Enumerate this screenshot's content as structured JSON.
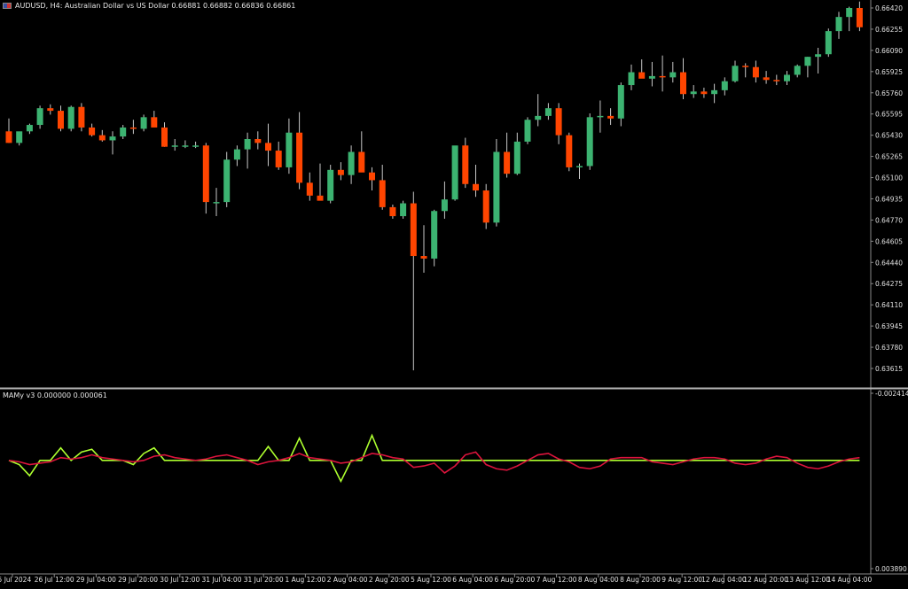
{
  "header": {
    "symbol_line": "AUDUSD, H4:  Australian Dollar vs US Dollar  0.66881 0.66882 0.66836 0.66861",
    "indicator_line": "MAMy v3 0.000000 0.000061"
  },
  "colors": {
    "background": "#000000",
    "bull": "#3cb371",
    "bear": "#ff4500",
    "wick": "#c8c8c8",
    "separator": "#b4b4b4",
    "line_main": "#adff2f",
    "line_signal": "#dc143c",
    "axis_text": "#e0e0e0"
  },
  "chart_data": [
    {
      "type": "candlestick",
      "title": "AUDUSD, H4:  Australian Dollar vs US Dollar",
      "ylim": [
        0.635,
        0.665
      ],
      "y_ticks": [
        "0.66420",
        "0.66255",
        "0.66090",
        "0.65925",
        "0.65760",
        "0.65595",
        "0.65430",
        "0.65265",
        "0.65100",
        "0.64935",
        "0.64770",
        "0.64605",
        "0.64440",
        "0.64275",
        "0.64110",
        "0.63945",
        "0.63780",
        "0.63615"
      ],
      "x_ticks": [
        "25 Jul 2024",
        "26 Jul 12:00",
        "29 Jul 04:00",
        "29 Jul 20:00",
        "30 Jul 12:00",
        "31 Jul 04:00",
        "31 Jul 20:00",
        "1 Aug 12:00",
        "2 Aug 04:00",
        "2 Aug 20:00",
        "5 Aug 12:00",
        "6 Aug 04:00",
        "6 Aug 20:00",
        "7 Aug 12:00",
        "8 Aug 04:00",
        "8 Aug 20:00",
        "9 Aug 12:00",
        "12 Aug 04:00",
        "12 Aug 20:00",
        "13 Aug 12:00",
        "14 Aug 04:00"
      ],
      "candles": [
        [
          0.6546,
          0.6556,
          0.6537,
          0.6537
        ],
        [
          0.6537,
          0.6545,
          0.6535,
          0.6546
        ],
        [
          0.6546,
          0.6552,
          0.6544,
          0.6551
        ],
        [
          0.6551,
          0.6566,
          0.6548,
          0.6564
        ],
        [
          0.6564,
          0.6567,
          0.6559,
          0.6562
        ],
        [
          0.6562,
          0.6566,
          0.6546,
          0.6548
        ],
        [
          0.6548,
          0.6566,
          0.6546,
          0.6565
        ],
        [
          0.6565,
          0.6568,
          0.6546,
          0.6549
        ],
        [
          0.6549,
          0.6552,
          0.6542,
          0.6543
        ],
        [
          0.6543,
          0.6547,
          0.6538,
          0.6539
        ],
        [
          0.6539,
          0.6546,
          0.6528,
          0.6542
        ],
        [
          0.6542,
          0.6551,
          0.654,
          0.6549
        ],
        [
          0.6549,
          0.6555,
          0.6544,
          0.6548
        ],
        [
          0.6548,
          0.6559,
          0.6546,
          0.6557
        ],
        [
          0.6557,
          0.6562,
          0.6551,
          0.6549
        ],
        [
          0.6549,
          0.6553,
          0.6534,
          0.6534
        ],
        [
          0.6534,
          0.654,
          0.6531,
          0.6535
        ],
        [
          0.6535,
          0.6539,
          0.6533,
          0.6535
        ],
        [
          0.6535,
          0.6538,
          0.6533,
          0.6535
        ],
        [
          0.6535,
          0.6537,
          0.6482,
          0.6491
        ],
        [
          0.6491,
          0.6502,
          0.648,
          0.6491
        ],
        [
          0.6491,
          0.653,
          0.6487,
          0.6524
        ],
        [
          0.6524,
          0.6535,
          0.6519,
          0.6532
        ],
        [
          0.6532,
          0.6545,
          0.6517,
          0.654
        ],
        [
          0.654,
          0.6546,
          0.6532,
          0.6537
        ],
        [
          0.6537,
          0.6552,
          0.6519,
          0.6531
        ],
        [
          0.6531,
          0.6538,
          0.6516,
          0.6518
        ],
        [
          0.6518,
          0.6556,
          0.6513,
          0.6545
        ],
        [
          0.6545,
          0.6561,
          0.6501,
          0.6506
        ],
        [
          0.6506,
          0.6514,
          0.6492,
          0.6496
        ],
        [
          0.6496,
          0.6521,
          0.6494,
          0.6492
        ],
        [
          0.6492,
          0.652,
          0.649,
          0.6516
        ],
        [
          0.6516,
          0.6522,
          0.6508,
          0.6512
        ],
        [
          0.6512,
          0.6535,
          0.6505,
          0.653
        ],
        [
          0.653,
          0.6546,
          0.652,
          0.6514
        ],
        [
          0.6514,
          0.6518,
          0.65,
          0.6508
        ],
        [
          0.6508,
          0.652,
          0.6485,
          0.6487
        ],
        [
          0.6487,
          0.6489,
          0.6478,
          0.648
        ],
        [
          0.648,
          0.6492,
          0.6478,
          0.649
        ],
        [
          0.649,
          0.6499,
          0.636,
          0.6449
        ],
        [
          0.6449,
          0.6473,
          0.6436,
          0.6447
        ],
        [
          0.6447,
          0.6485,
          0.6441,
          0.6484
        ],
        [
          0.6484,
          0.6507,
          0.6478,
          0.6493
        ],
        [
          0.6493,
          0.6533,
          0.6492,
          0.6535
        ],
        [
          0.6535,
          0.6541,
          0.6502,
          0.6505
        ],
        [
          0.6505,
          0.652,
          0.6495,
          0.65
        ],
        [
          0.65,
          0.6505,
          0.647,
          0.6475
        ],
        [
          0.6475,
          0.654,
          0.6472,
          0.653
        ],
        [
          0.653,
          0.6545,
          0.651,
          0.6513
        ],
        [
          0.6513,
          0.6545,
          0.6512,
          0.6538
        ],
        [
          0.6538,
          0.6557,
          0.6536,
          0.6555
        ],
        [
          0.6555,
          0.6575,
          0.655,
          0.6558
        ],
        [
          0.6558,
          0.6568,
          0.6555,
          0.6564
        ],
        [
          0.6564,
          0.6568,
          0.6536,
          0.6543
        ],
        [
          0.6543,
          0.6545,
          0.6515,
          0.6518
        ],
        [
          0.6518,
          0.6521,
          0.6509,
          0.6519
        ],
        [
          0.6519,
          0.656,
          0.6516,
          0.6557
        ],
        [
          0.6557,
          0.657,
          0.6545,
          0.6558
        ],
        [
          0.6558,
          0.6564,
          0.6551,
          0.6556
        ],
        [
          0.6556,
          0.6584,
          0.655,
          0.6582
        ],
        [
          0.6582,
          0.6598,
          0.6578,
          0.6592
        ],
        [
          0.6592,
          0.6602,
          0.6588,
          0.6587
        ],
        [
          0.6587,
          0.66,
          0.6581,
          0.6589
        ],
        [
          0.6589,
          0.6605,
          0.6577,
          0.6588
        ],
        [
          0.6588,
          0.66,
          0.6584,
          0.6592
        ],
        [
          0.6592,
          0.6603,
          0.6571,
          0.6575
        ],
        [
          0.6575,
          0.6582,
          0.6572,
          0.6577
        ],
        [
          0.6577,
          0.658,
          0.6572,
          0.6575
        ],
        [
          0.6575,
          0.6583,
          0.6568,
          0.6578
        ],
        [
          0.6578,
          0.6588,
          0.6574,
          0.6585
        ],
        [
          0.6585,
          0.6601,
          0.6584,
          0.6597
        ],
        [
          0.6597,
          0.6599,
          0.6588,
          0.6596
        ],
        [
          0.6596,
          0.6601,
          0.6584,
          0.6588
        ],
        [
          0.6588,
          0.6593,
          0.6583,
          0.6586
        ],
        [
          0.6586,
          0.659,
          0.6582,
          0.6585
        ],
        [
          0.6585,
          0.6593,
          0.6582,
          0.659
        ],
        [
          0.659,
          0.6598,
          0.6588,
          0.6597
        ],
        [
          0.6597,
          0.6604,
          0.6588,
          0.6604
        ],
        [
          0.6604,
          0.6611,
          0.6591,
          0.6606
        ],
        [
          0.6606,
          0.6626,
          0.6604,
          0.6624
        ],
        [
          0.6624,
          0.6639,
          0.6618,
          0.6635
        ],
        [
          0.6635,
          0.6643,
          0.6624,
          0.6642
        ],
        [
          0.6642,
          0.6647,
          0.6624,
          0.6627
        ],
        [
          0.6627,
          0.664,
          0.6621,
          0.6634
        ],
        [
          0.6634,
          0.6643,
          0.6614,
          0.6627
        ]
      ]
    },
    {
      "type": "line",
      "title": "MAMy v3 0.000000 0.000061",
      "ylim": [
        -0.002414,
        0.00389
      ],
      "y_ticks": [
        "0.003890",
        "-0.002414"
      ],
      "series": [
        {
          "name": "",
          "values": [
            0.0,
            0.00015,
            0.00055,
            0.0,
            0.0,
            -0.00045,
            0.0,
            -0.0003,
            -0.0004,
            0.0,
            0.0,
            0.0,
            0.00015,
            -0.00025,
            -0.00045,
            0.0,
            0.0,
            0.0,
            0.0,
            0.0,
            0.0,
            0.0,
            0.0,
            0.0,
            0.0,
            -0.0005,
            0.0,
            0.0,
            -0.0008,
            0.0,
            0.0,
            0.0,
            0.00075,
            0.0,
            0.0,
            -0.0009,
            0.0,
            0.0,
            0.0,
            0.0,
            0.0,
            0.0,
            0.0,
            0.0,
            0.0,
            0.0,
            0.0,
            0.0,
            0.0,
            0.0,
            0.0,
            0.0,
            0.0,
            0.0,
            0.0,
            0.0,
            0.0,
            0.0,
            0.0,
            0.0,
            0.0,
            0.0,
            0.0,
            0.0,
            0.0,
            0.0,
            0.0,
            0.0,
            0.0,
            0.0,
            0.0,
            0.0,
            0.0,
            0.0,
            0.0,
            0.0,
            0.0,
            0.0,
            0.0,
            0.0,
            0.0,
            0.0,
            0.0,
            0.0,
            0.0
          ]
        },
        {
          "name": "",
          "values": [
            0.0,
            5e-05,
            0.00015,
            0.0001,
            5e-05,
            -0.0001,
            -5e-05,
            -0.0001,
            -0.0002,
            -0.0001,
            -5e-05,
            0.0,
            5e-05,
            0.0,
            -0.00015,
            -0.0002,
            -0.0001,
            -5e-05,
            0.0,
            -5e-05,
            -0.00015,
            -0.0002,
            -0.0001,
            0.0,
            0.00015,
            5e-05,
            0.0,
            -0.0001,
            -0.00025,
            -0.0001,
            -5e-05,
            0.0,
            0.0001,
            5e-05,
            -0.0001,
            -0.00025,
            -0.0002,
            -0.0001,
            -5e-05,
            0.00025,
            0.0002,
            0.0001,
            0.00045,
            0.0002,
            -0.0002,
            -0.0003,
            0.00015,
            0.0003,
            0.00035,
            0.0002,
            0.0,
            -0.0002,
            -0.00025,
            -5e-05,
            5e-05,
            0.00025,
            0.0003,
            0.0002,
            -5e-05,
            -0.0001,
            -0.0001,
            -0.0001,
            5e-05,
            0.0001,
            0.00015,
            5e-05,
            -5e-05,
            -0.0001,
            -0.0001,
            -5e-05,
            0.0001,
            0.00015,
            0.0001,
            -5e-05,
            -0.00015,
            -0.0001,
            0.0001,
            0.00025,
            0.0003,
            0.0002,
            5e-05,
            -5e-05,
            -0.0001,
            -0.00015,
            -0.0002
          ]
        }
      ]
    }
  ]
}
